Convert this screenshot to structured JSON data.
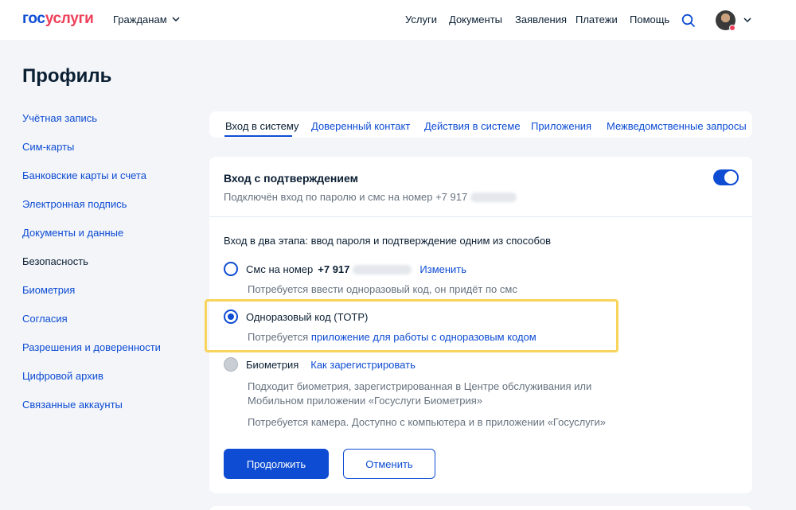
{
  "header": {
    "logo_part1": "гос",
    "logo_part2": "услуги",
    "audience": "Гражданам",
    "nav": [
      "Услуги",
      "Документы",
      "Заявления",
      "Платежи",
      "Помощь"
    ]
  },
  "page": {
    "title": "Профиль"
  },
  "sidebar": {
    "items": [
      "Учётная запись",
      "Сим-карты",
      "Банковские карты и счета",
      "Электронная подпись",
      "Документы и данные",
      "Безопасность",
      "Биометрия",
      "Согласия",
      "Разрешения и доверенности",
      "Цифровой архив",
      "Связанные аккаунты"
    ],
    "active_label": "Безопасность"
  },
  "tabs": [
    "Вход в систему",
    "Доверенный контакт",
    "Действия в системе",
    "Приложения",
    "Межведомственные запросы"
  ],
  "login_card": {
    "title": "Вход с подтверждением",
    "subtitle": "Подключён вход по паролю и смс на номер +7 917",
    "toggle_on": true,
    "section_text": "Вход в два этапа: ввод пароля и подтверждение одним из способов",
    "sms_option": {
      "label": "Смс на номер",
      "phone_prefix": "+7 917",
      "change_link": "Изменить",
      "hint": "Потребуется ввести одноразовый код, он придёт по смс"
    },
    "totp_option": {
      "label": "Одноразовый код (TOTP)",
      "hint_prefix": "Потребуется",
      "hint_link": "приложение для работы с одноразовым кодом"
    },
    "biometry_option": {
      "label": "Биометрия",
      "register_link": "Как зарегистрировать",
      "hint_line1": "Подходит биометрия, зарегистрированная в Центре обслуживания или",
      "hint_line2": "Мобильном приложении «Госуслуги Биометрия»",
      "hint_line3": "Потребуется камера. Доступно с компьютера и в приложении «Госуслуги»"
    },
    "continue_button": "Продолжить",
    "cancel_button": "Отменить"
  },
  "colors": {
    "primary": "#0d4cd3",
    "brand_red": "#ee3f58",
    "highlight": "#f8d45c",
    "background": "#f3f5f9"
  },
  "icons": [
    "search-icon",
    "chevron-down-icon",
    "avatar"
  ]
}
